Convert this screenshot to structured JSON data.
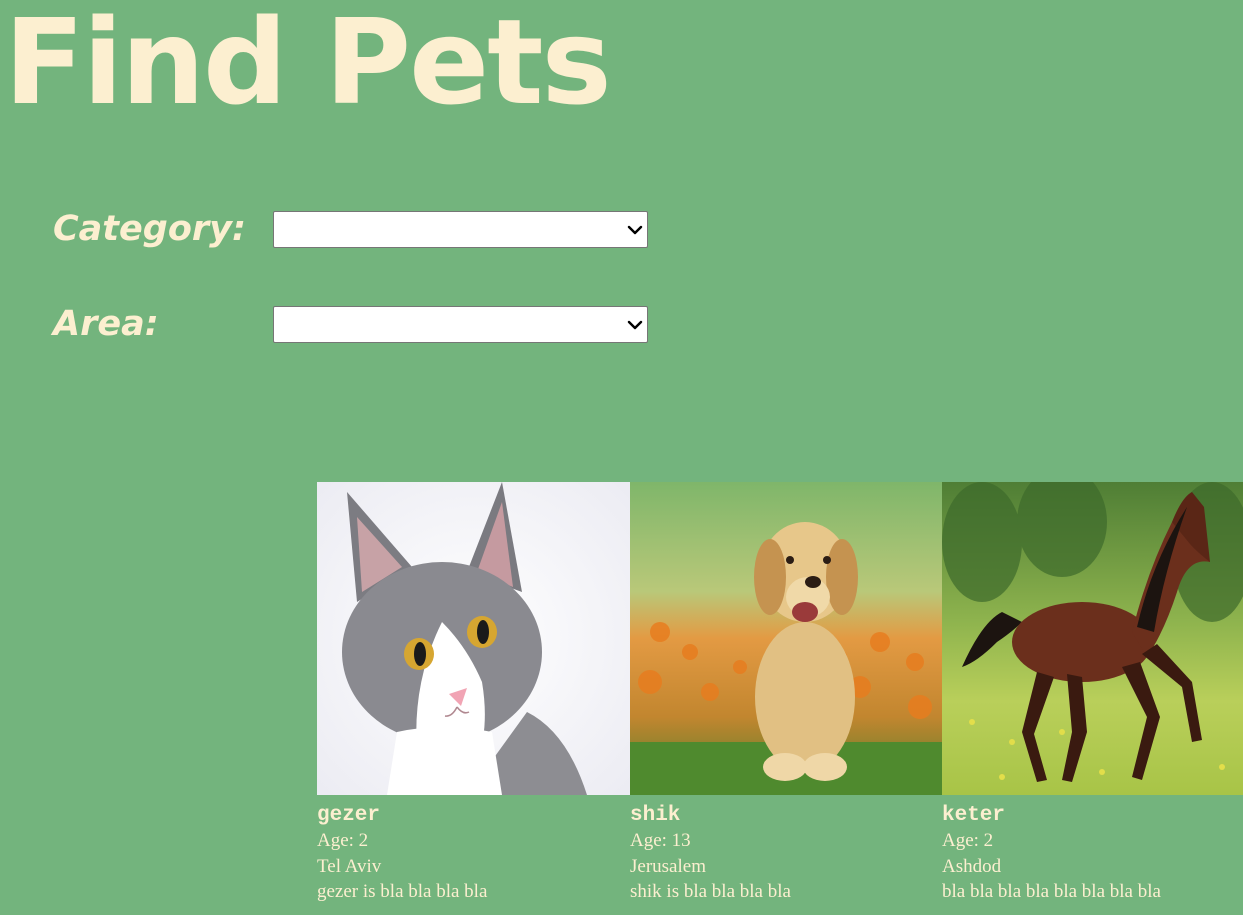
{
  "header": {
    "title": "Find Pets"
  },
  "filters": {
    "category_label": "Category:",
    "category_value": "",
    "area_label": "Area:",
    "area_value": ""
  },
  "pets": [
    {
      "name": "gezer",
      "age": "Age: 2",
      "location": "Tel Aviv",
      "description": "gezer is bla bla bla bla",
      "photo_icon": "cat-photo"
    },
    {
      "name": "shik",
      "age": "Age: 13",
      "location": "Jerusalem",
      "description": "shik is bla bla bla bla",
      "photo_icon": "dog-photo"
    },
    {
      "name": "keter",
      "age": "Age: 2",
      "location": "Ashdod",
      "description": "bla bla bla bla bla bla bla bla",
      "photo_icon": "horse-photo"
    }
  ],
  "colors": {
    "background": "#73b47d",
    "text_cream": "#fcefd0"
  }
}
